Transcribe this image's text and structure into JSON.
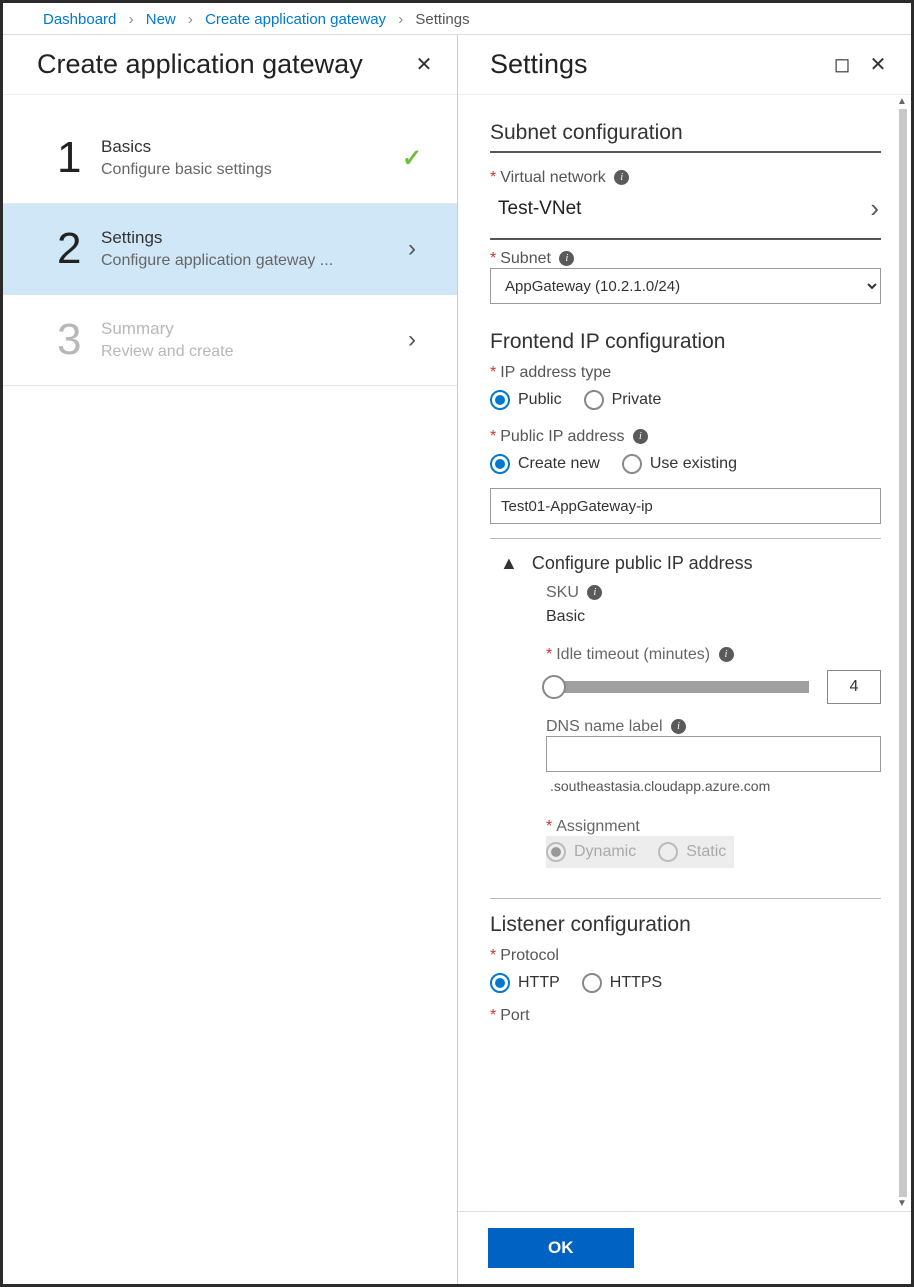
{
  "breadcrumb": {
    "items": [
      "Dashboard",
      "New",
      "Create application gateway"
    ],
    "current": "Settings"
  },
  "leftPane": {
    "title": "Create application gateway",
    "steps": [
      {
        "num": "1",
        "title": "Basics",
        "sub": "Configure basic settings",
        "status": "done"
      },
      {
        "num": "2",
        "title": "Settings",
        "sub": "Configure application gateway ...",
        "status": "active"
      },
      {
        "num": "3",
        "title": "Summary",
        "sub": "Review and create",
        "status": "disabled"
      }
    ]
  },
  "rightPane": {
    "title": "Settings",
    "subnet": {
      "section": "Subnet configuration",
      "vnet_label": "Virtual network",
      "vnet_value": "Test-VNet",
      "subnet_label": "Subnet",
      "subnet_value": "AppGateway (10.2.1.0/24)"
    },
    "frontend": {
      "section": "Frontend IP configuration",
      "ip_type_label": "IP address type",
      "ip_type_public": "Public",
      "ip_type_private": "Private",
      "pip_label": "Public IP address",
      "pip_create": "Create new",
      "pip_use": "Use existing",
      "pip_name_value": "Test01-AppGateway-ip",
      "expander_label": "Configure public IP address",
      "sku_label": "SKU",
      "sku_value": "Basic",
      "idle_label": "Idle timeout (minutes)",
      "idle_value": "4",
      "dns_label": "DNS name label",
      "dns_value": "",
      "dns_suffix": ".southeastasia.cloudapp.azure.com",
      "assign_label": "Assignment",
      "assign_dynamic": "Dynamic",
      "assign_static": "Static"
    },
    "listener": {
      "section": "Listener configuration",
      "proto_label": "Protocol",
      "proto_http": "HTTP",
      "proto_https": "HTTPS",
      "port_label": "Port"
    },
    "ok_label": "OK"
  }
}
